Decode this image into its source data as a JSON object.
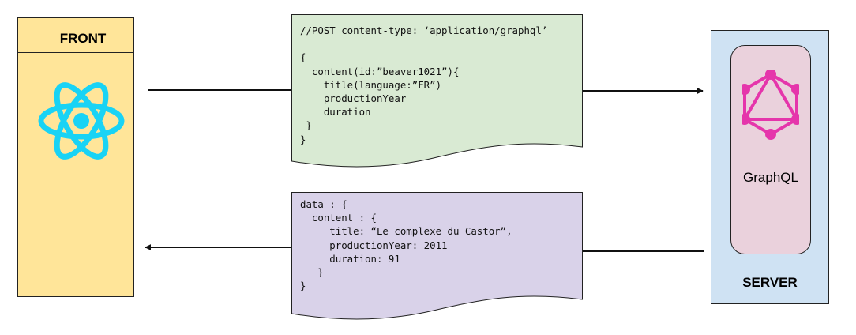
{
  "front": {
    "title": "FRONT",
    "icon": "react-atom-icon"
  },
  "server": {
    "title": "SERVER",
    "service_label": "GraphQL",
    "icon": "graphql-icon"
  },
  "request": {
    "lines": [
      "//POST content-type: ‘application/graphql’",
      "",
      "{",
      "  content(id:”beaver1021”){",
      "    title(language:”FR”)",
      "    productionYear",
      "    duration",
      " }",
      "}"
    ]
  },
  "response": {
    "lines": [
      "data : {",
      "  content : {",
      "     title: “Le complexe du Castor”,",
      "     productionYear: 2011",
      "     duration: 91",
      "   }",
      "}"
    ]
  },
  "colors": {
    "front_fill": "#ffe599",
    "server_fill": "#cfe2f3",
    "server_inner_fill": "#ead1dc",
    "request_fill": "#d9ead3",
    "response_fill": "#d9d2e9",
    "react_cyan": "#19d3f5",
    "graphql_pink": "#e535ab"
  }
}
